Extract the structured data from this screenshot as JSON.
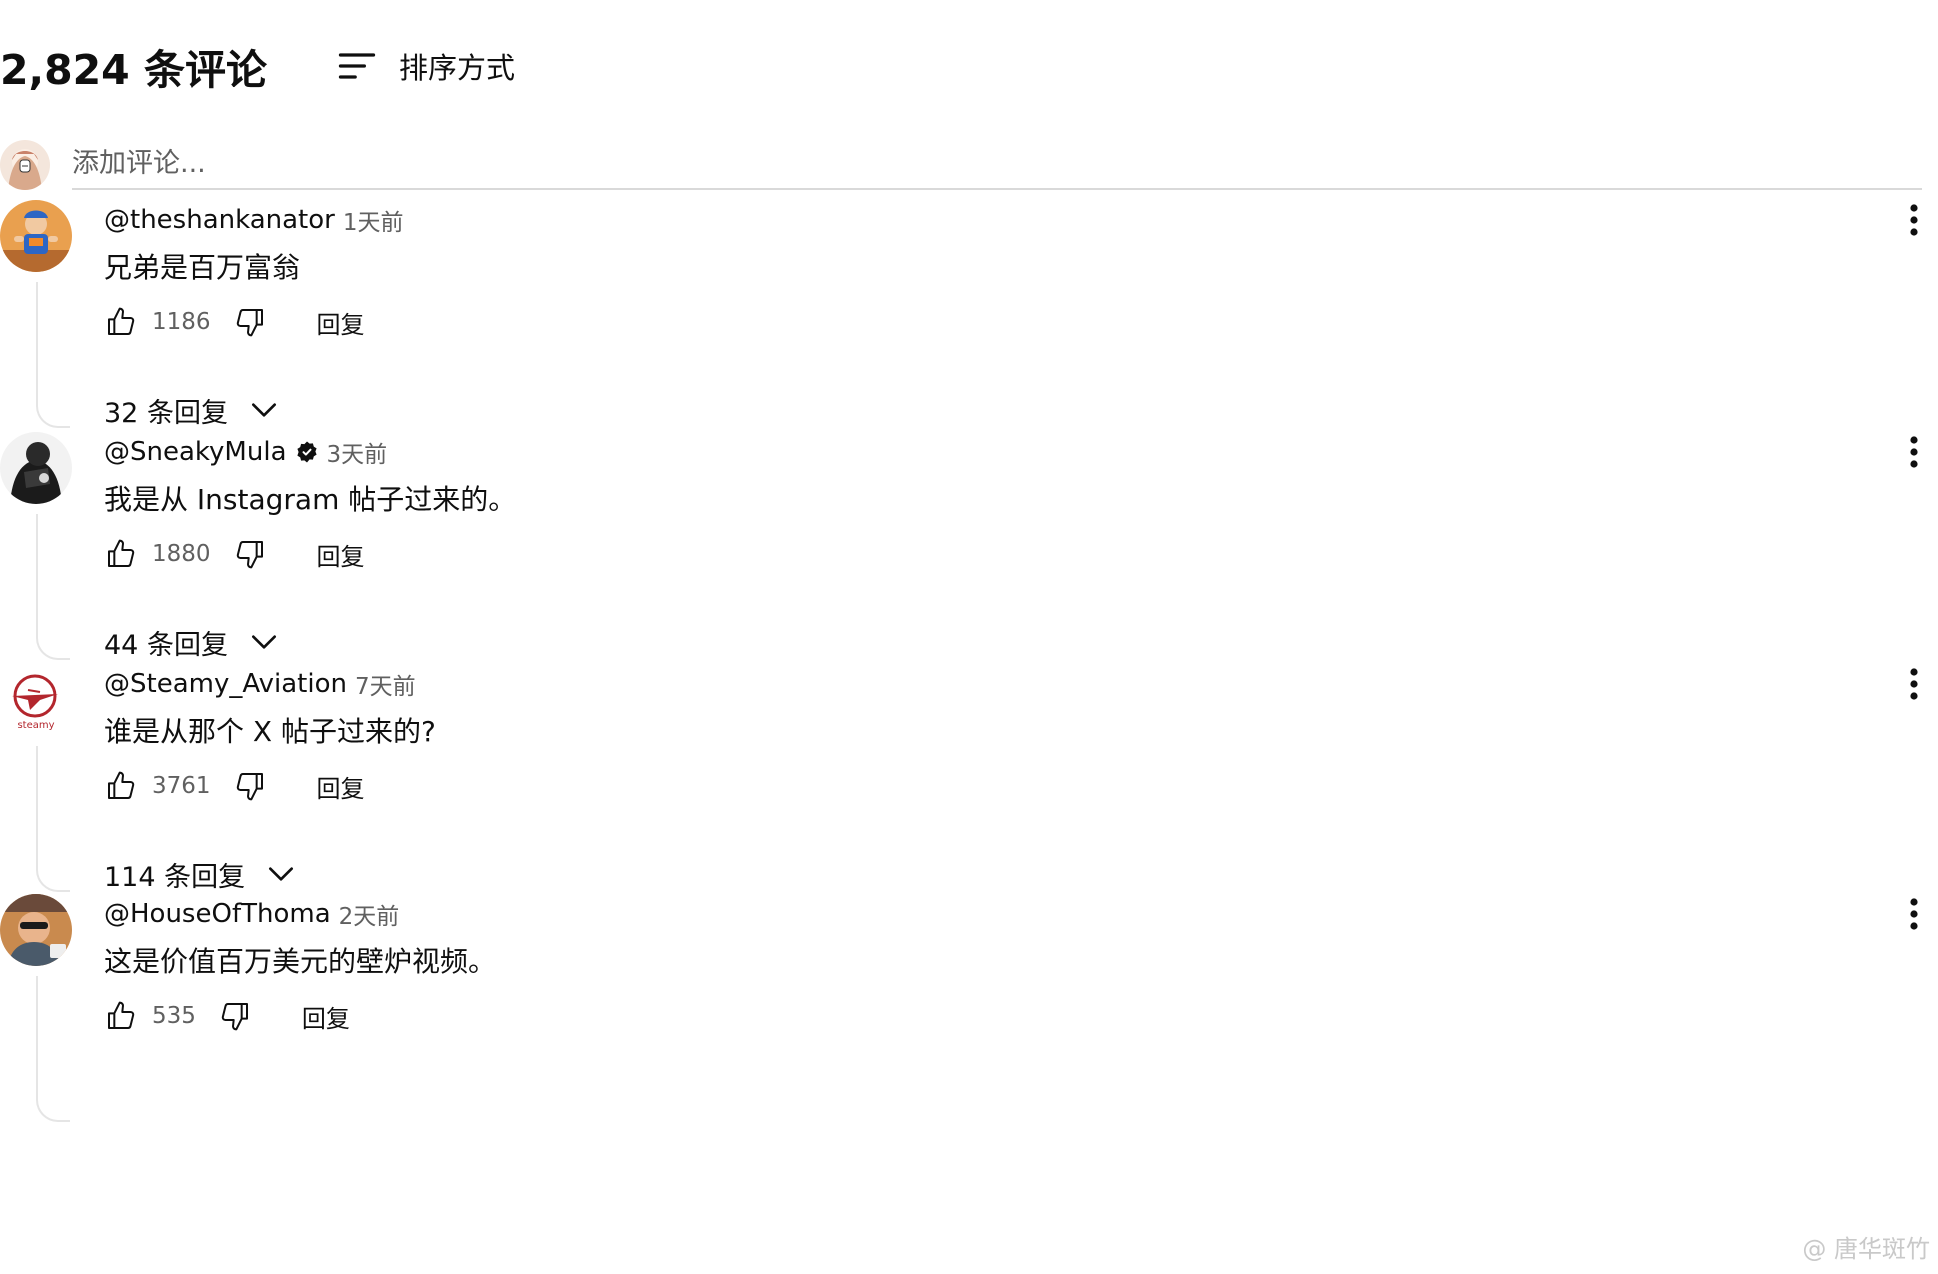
{
  "header": {
    "comment_count": "2,824 条评论",
    "sort_label": "排序方式",
    "sort_icon": "sort-icon"
  },
  "add_comment": {
    "placeholder": "添加评论..."
  },
  "comments": [
    {
      "author": "@theshankanator",
      "verified": false,
      "time": "1天前",
      "text": "兄弟是百万富翁",
      "likes": "1186",
      "reply_label": "回复",
      "replies_label": "32 条回复"
    },
    {
      "author": "@SneakyMula",
      "verified": true,
      "time": "3天前",
      "text": "我是从 Instagram 帖子过来的。",
      "likes": "1880",
      "reply_label": "回复",
      "replies_label": "44 条回复"
    },
    {
      "author": "@Steamy_Aviation",
      "verified": false,
      "time": "7天前",
      "text": "谁是从那个 X 帖子过来的?",
      "likes": "3761",
      "reply_label": "回复",
      "replies_label": "114 条回复"
    },
    {
      "author": "@HouseOfThoma",
      "verified": false,
      "time": "2天前",
      "text": "这是价值百万美元的壁炉视频。",
      "likes": "535",
      "reply_label": "回复"
    }
  ],
  "watermark": "@ 唐华斑竹"
}
